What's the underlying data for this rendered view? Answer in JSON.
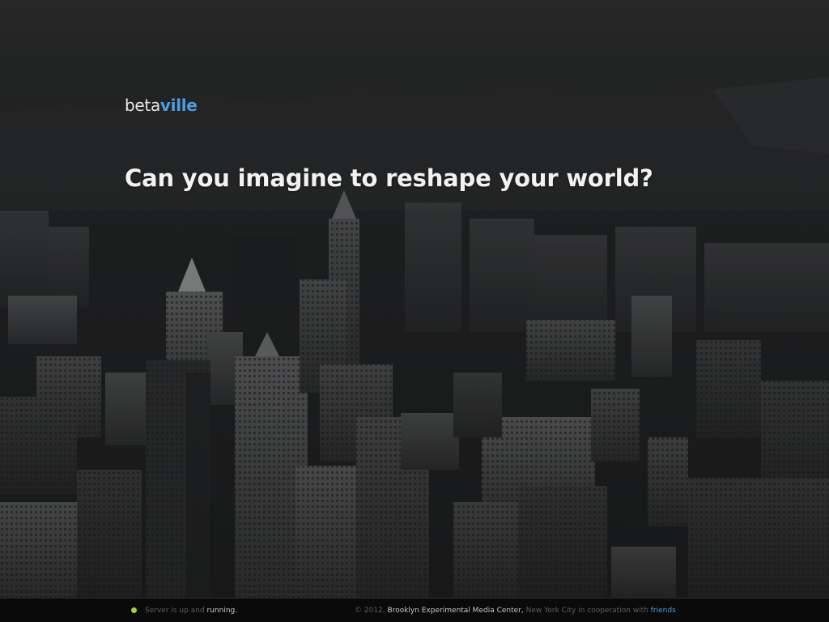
{
  "brand": {
    "prefix": "beta",
    "accent": "ville",
    "accent_color": "#4a9fe0"
  },
  "hero": {
    "headline": "Can you imagine to reshape your world?"
  },
  "footer": {
    "status_prefix": "Server is up and",
    "status_state": "running.",
    "status_color": "#9ed92b",
    "copyright_prefix": "© 2012,",
    "organization": "Brooklyn Experimental Media Center,",
    "location": "New York City in cooperation with",
    "friends_link": "friends"
  }
}
